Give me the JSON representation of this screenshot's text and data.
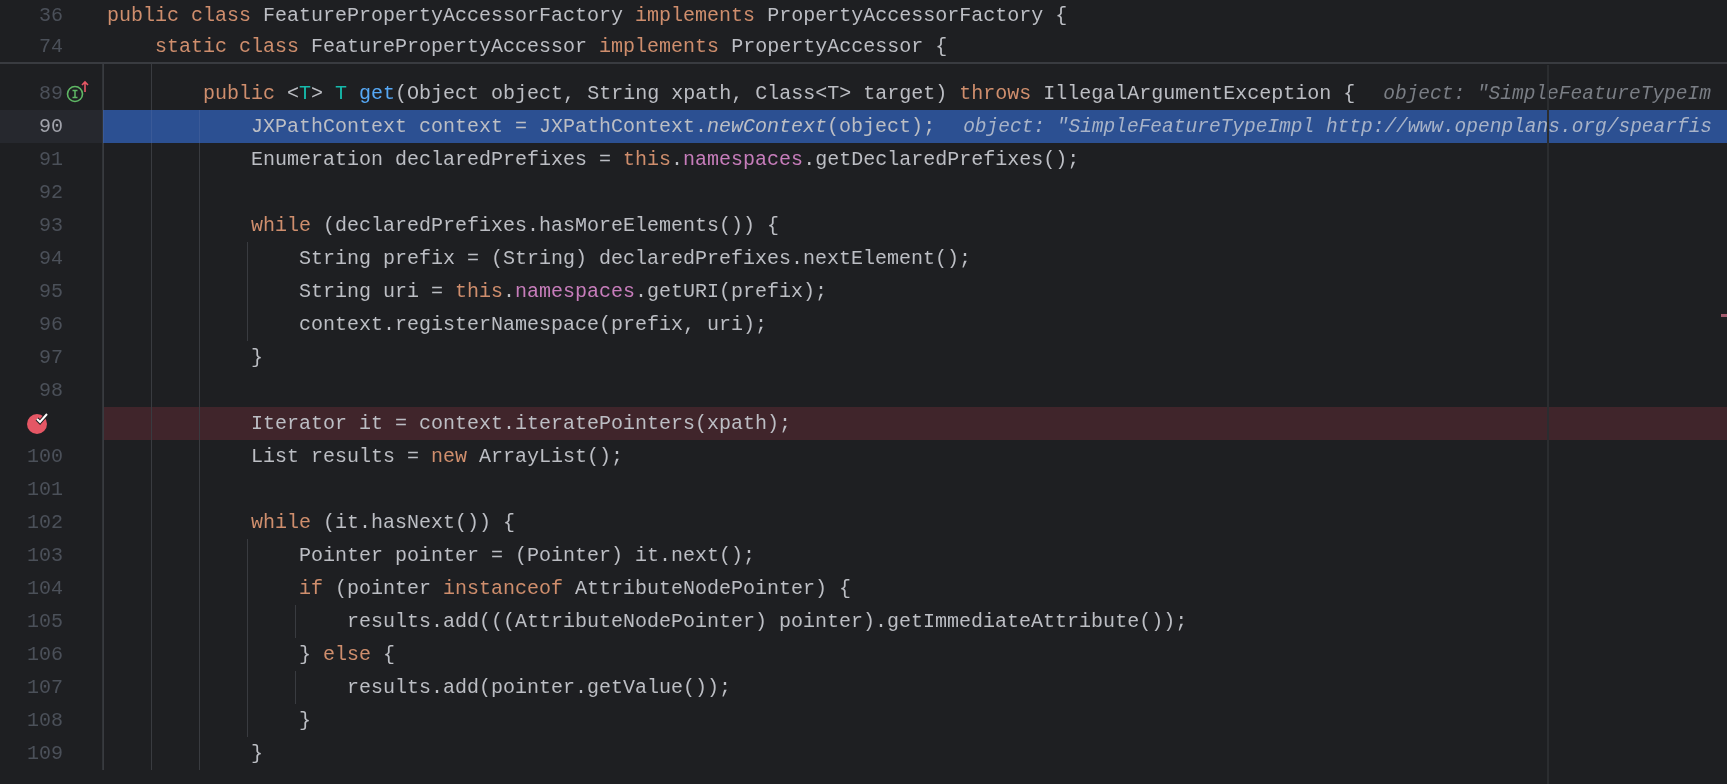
{
  "sticky_header": [
    {
      "number": "36",
      "tokens": [
        {
          "kind": "keyword",
          "text": "public class"
        },
        {
          "kind": "plain",
          "text": " FeaturePropertyAccessorFactory "
        },
        {
          "kind": "keyword",
          "text": "implements"
        },
        {
          "kind": "plain",
          "text": " PropertyAccessorFactory {"
        }
      ]
    },
    {
      "number": "74",
      "tokens": [
        {
          "kind": "keyword",
          "text": "    static class"
        },
        {
          "kind": "plain",
          "text": " FeaturePropertyAccessor "
        },
        {
          "kind": "keyword",
          "text": "implements"
        },
        {
          "kind": "plain",
          "text": " PropertyAccessor {"
        }
      ]
    }
  ],
  "lines": [
    {
      "number": "89",
      "kind": "normal",
      "implemented": true,
      "tokens": [
        {
          "kind": "keyword",
          "text": "        public"
        },
        {
          "kind": "plain",
          "text": " <"
        },
        {
          "kind": "type_param",
          "text": "T"
        },
        {
          "kind": "plain",
          "text": "> "
        },
        {
          "kind": "type_param",
          "text": "T "
        },
        {
          "kind": "method",
          "text": "get"
        },
        {
          "kind": "plain",
          "text": "(Object object, String xpath, Class<T> target) "
        },
        {
          "kind": "keyword",
          "text": "throws"
        },
        {
          "kind": "plain",
          "text": " IllegalArgumentException {"
        }
      ],
      "hint": "object: \"SimpleFeatureTypeIm"
    },
    {
      "number": "90",
      "kind": "current",
      "tokens": [
        {
          "kind": "plain",
          "text": "            JXPathContext context = JXPathContext."
        },
        {
          "kind": "static_call",
          "text": "newContext"
        },
        {
          "kind": "plain",
          "text": "(object);"
        }
      ],
      "hint": "object: \"SimpleFeatureTypeImpl http://www.openplans.org/spearfis"
    },
    {
      "number": "91",
      "kind": "normal",
      "tokens": [
        {
          "kind": "plain",
          "text": "            Enumeration declaredPrefixes = "
        },
        {
          "kind": "keyword",
          "text": "this"
        },
        {
          "kind": "plain",
          "text": "."
        },
        {
          "kind": "field",
          "text": "namespaces"
        },
        {
          "kind": "plain",
          "text": ".getDeclaredPrefixes();"
        }
      ]
    },
    {
      "number": "92",
      "kind": "normal"
    },
    {
      "number": "93",
      "kind": "normal",
      "tokens": [
        {
          "kind": "keyword",
          "text": "            while"
        },
        {
          "kind": "plain",
          "text": " (declaredPrefixes.hasMoreElements()) {"
        }
      ]
    },
    {
      "number": "94",
      "kind": "normal",
      "tokens": [
        {
          "kind": "plain",
          "text": "                String prefix = (String) declaredPrefixes.nextElement();"
        }
      ]
    },
    {
      "number": "95",
      "kind": "normal",
      "tokens": [
        {
          "kind": "plain",
          "text": "                String uri = "
        },
        {
          "kind": "keyword",
          "text": "this"
        },
        {
          "kind": "plain",
          "text": "."
        },
        {
          "kind": "field",
          "text": "namespaces"
        },
        {
          "kind": "plain",
          "text": ".getURI(prefix);"
        }
      ]
    },
    {
      "number": "96",
      "kind": "normal",
      "tokens": [
        {
          "kind": "plain",
          "text": "                context.registerNamespace(prefix, uri);"
        }
      ]
    },
    {
      "number": "97",
      "kind": "normal",
      "tokens": [
        {
          "kind": "plain",
          "text": "            }"
        }
      ]
    },
    {
      "number": "98",
      "kind": "normal"
    },
    {
      "kind": "breakpoint",
      "tokens": [
        {
          "kind": "plain",
          "text": "            Iterator it = context.iteratePointers(xpath);"
        }
      ]
    },
    {
      "number": "100",
      "kind": "normal",
      "tokens": [
        {
          "kind": "plain",
          "text": "            List results = "
        },
        {
          "kind": "keyword",
          "text": "new"
        },
        {
          "kind": "plain",
          "text": " ArrayList();"
        }
      ]
    },
    {
      "number": "101",
      "kind": "normal"
    },
    {
      "number": "102",
      "kind": "normal",
      "tokens": [
        {
          "kind": "keyword",
          "text": "            while"
        },
        {
          "kind": "plain",
          "text": " (it.hasNext()) {"
        }
      ]
    },
    {
      "number": "103",
      "kind": "normal",
      "tokens": [
        {
          "kind": "plain",
          "text": "                Pointer pointer = (Pointer) it.next();"
        }
      ]
    },
    {
      "number": "104",
      "kind": "normal",
      "tokens": [
        {
          "kind": "keyword",
          "text": "                if"
        },
        {
          "kind": "plain",
          "text": " (pointer "
        },
        {
          "kind": "keyword",
          "text": "instanceof"
        },
        {
          "kind": "plain",
          "text": " AttributeNodePointer) {"
        }
      ]
    },
    {
      "number": "105",
      "kind": "normal",
      "tokens": [
        {
          "kind": "plain",
          "text": "                    results.add(((AttributeNodePointer) pointer).getImmediateAttribute());"
        }
      ]
    },
    {
      "number": "106",
      "kind": "normal",
      "tokens": [
        {
          "kind": "plain",
          "text": "                } "
        },
        {
          "kind": "keyword",
          "text": "else"
        },
        {
          "kind": "plain",
          "text": " {"
        }
      ]
    },
    {
      "number": "107",
      "kind": "normal",
      "tokens": [
        {
          "kind": "plain",
          "text": "                    results.add(pointer.getValue());"
        }
      ]
    },
    {
      "number": "108",
      "kind": "normal",
      "tokens": [
        {
          "kind": "plain",
          "text": "                }"
        }
      ]
    },
    {
      "number": "109",
      "kind": "normal",
      "tokens": [
        {
          "kind": "plain",
          "text": "            }"
        }
      ]
    }
  ]
}
